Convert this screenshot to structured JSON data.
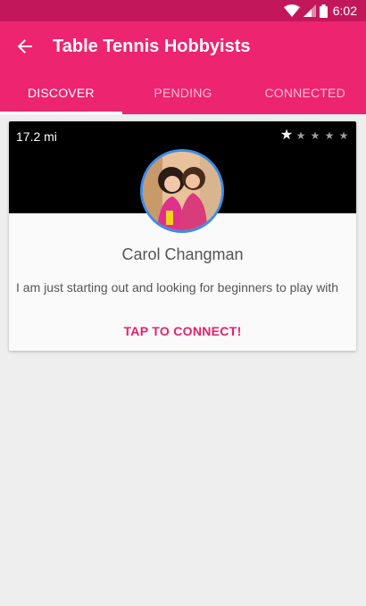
{
  "status_bar": {
    "time": "6:02"
  },
  "app_bar": {
    "title": "Table Tennis Hobbyists"
  },
  "tabs": [
    {
      "label": "DISCOVER",
      "active": true
    },
    {
      "label": "PENDING",
      "active": false
    },
    {
      "label": "CONNECTED",
      "active": false
    }
  ],
  "card": {
    "distance": "17.2 mi",
    "rating": {
      "value": 1,
      "max": 5
    },
    "name": "Carol Changman",
    "description": "I am just starting out and looking for beginners to play with",
    "connect_label": "TAP TO CONNECT!"
  },
  "colors": {
    "status_bar": "#c2185b",
    "primary": "#ed2470",
    "accent_text": "#e0236c",
    "avatar_border": "#3f8be6"
  }
}
